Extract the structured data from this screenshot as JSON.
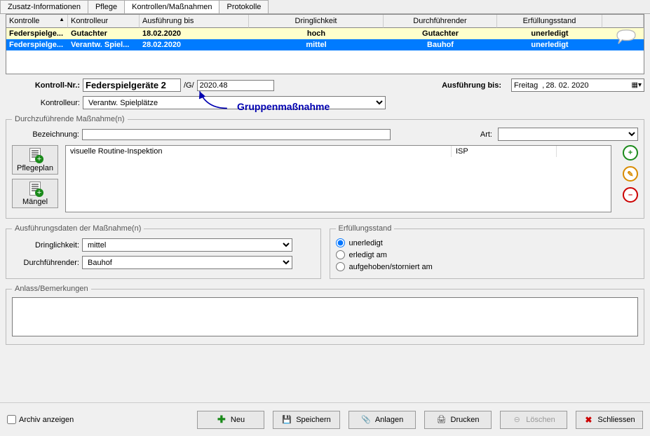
{
  "tabs": [
    "Zusatz-Informationen",
    "Pflege",
    "Kontrollen/Maßnahmen",
    "Protokolle"
  ],
  "activeTab": "Kontrollen/Maßnahmen",
  "grid": {
    "headers": [
      "Kontrolle",
      "Kontrolleur",
      "Ausführung bis",
      "Dringlichkeit",
      "Durchführender",
      "Erfüllungsstand"
    ],
    "rows": [
      {
        "kontrolle": "Federspielge...",
        "kontrolleur": "Gutachter",
        "ausfuehrung": "18.02.2020",
        "dringlichkeit": "hoch",
        "durchfuehrender": "Gutachter",
        "erfuellung": "unerledigt",
        "style": "row-yellow"
      },
      {
        "kontrolle": "Federspielge...",
        "kontrolleur": "Verantw. Spiel...",
        "ausfuehrung": "28.02.2020",
        "dringlichkeit": "mittel",
        "durchfuehrender": "Bauhof",
        "erfuellung": "unerledigt",
        "style": "row-blue"
      }
    ]
  },
  "form": {
    "labels": {
      "kontrollnr": "Kontroll-Nr.:",
      "kontrolleur": "Kontrolleur:",
      "ausfuehrung_bis": "Ausführung bis:",
      "bezeichnung": "Bezeichnung:",
      "art": "Art:",
      "dringlichkeit": "Dringlichkeit:",
      "durchfuehrender": "Durchführender:"
    },
    "kontrollnr_field": "Federspielgeräte 2",
    "kontrollnr_mid": "/G/",
    "kontrollnr_num": "2020.48",
    "kontrolleur_value": "Verantw. Spielplätze",
    "date_day": "Freitag",
    "date_sep": ",",
    "date_value": "28. 02. 2020",
    "art_value": "",
    "dringlichkeit_value": "mittel",
    "durchfuehrender_value": "Bauhof"
  },
  "annotation": "Gruppenmaßnahme",
  "fieldsets": {
    "maint": "Durchzuführende Maßnahme(n)",
    "exec": "Ausführungsdaten der Maßnahme(n)",
    "status": "Erfüllungsstand",
    "remarks": "Anlass/Bemerkungen"
  },
  "maint_rows": [
    {
      "bez": "visuelle Routine-Inspektion",
      "art": "ISP"
    }
  ],
  "side_buttons": {
    "pflegeplan": "Pflegeplan",
    "maengel": "Mängel"
  },
  "status_options": {
    "unerledigt": "unerledigt",
    "erledigt": "erledigt am",
    "storniert": "aufgehoben/storniert am"
  },
  "status_selected": "unerledigt",
  "archive_label": "Archiv anzeigen",
  "buttons": {
    "neu": "Neu",
    "speichern": "Speichern",
    "anlagen": "Anlagen",
    "drucken": "Drucken",
    "loeschen": "Löschen",
    "schliessen": "Schliessen"
  }
}
